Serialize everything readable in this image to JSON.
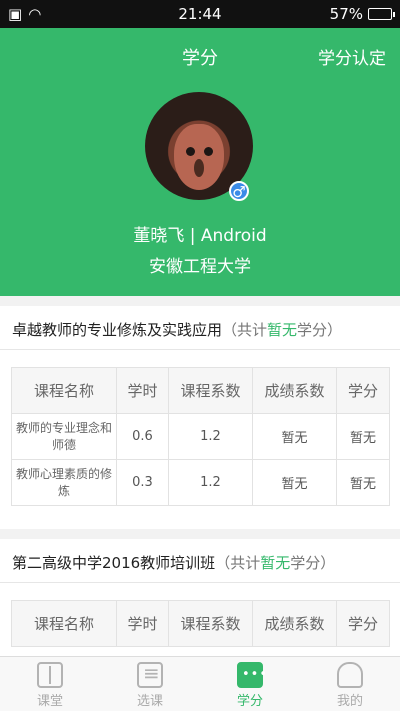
{
  "status": {
    "time": "21:44",
    "battery": "57%",
    "battery_level": 0.57
  },
  "header": {
    "title": "学分",
    "action": "学分认定",
    "name_line": "董晓飞 | Android",
    "school": "安徽工程大学",
    "gender_icon": "♂"
  },
  "table_headers": [
    "课程名称",
    "学时",
    "课程系数",
    "成绩系数",
    "学分"
  ],
  "sections": [
    {
      "title": "卓越教师的专业修炼及实践应用",
      "credit_prefix": "（共计",
      "credit_value": "暂无",
      "credit_suffix": "学分）",
      "rows": [
        [
          "教师的专业理念和师德",
          "0.6",
          "1.2",
          "暂无",
          "暂无"
        ],
        [
          "教师心理素质的修炼",
          "0.3",
          "1.2",
          "暂无",
          "暂无"
        ]
      ]
    },
    {
      "title": "第二高级中学2016教师培训班",
      "credit_prefix": "（共计",
      "credit_value": "暂无",
      "credit_suffix": "学分）"
    }
  ],
  "tabs": [
    "课堂",
    "选课",
    "学分",
    "我的"
  ]
}
